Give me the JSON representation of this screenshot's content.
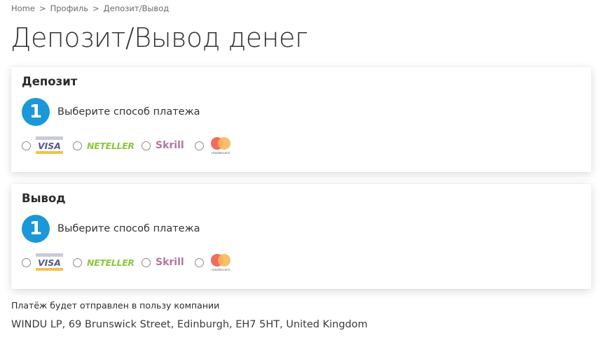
{
  "breadcrumb": {
    "items": [
      "Home",
      "Профиль",
      "Депозит/Вывод"
    ],
    "separator": ">"
  },
  "page_title": "Депозит/Вывод денег",
  "deposit": {
    "title": "Депозит",
    "step_number": "1",
    "step_text": "Выберите способ платежа"
  },
  "withdraw": {
    "title": "Вывод",
    "step_number": "1",
    "step_text": "Выберите способ платежа"
  },
  "payment_methods": {
    "visa": "VISA",
    "neteller": "NETELLER",
    "skrill": "Skrill",
    "mastercard": "mastercard"
  },
  "footer": {
    "note": "Платёж будет отправлен в пользу компании",
    "address": "WINDU LP, 69 Brunswick Street, Edinburgh, EH7 5HT, United Kingdom"
  },
  "colors": {
    "accent": "#1a98d8",
    "visa_blue": "#1a1f71",
    "visa_gold": "#f7b600",
    "neteller_green": "#8cc63e",
    "skrill_purple": "#862165",
    "mastercard_red": "#eb001b",
    "mastercard_yellow": "#f79e1b"
  },
  "icons": [
    "visa-logo-icon",
    "neteller-logo-icon",
    "skrill-logo-icon",
    "mastercard-logo-icon"
  ]
}
